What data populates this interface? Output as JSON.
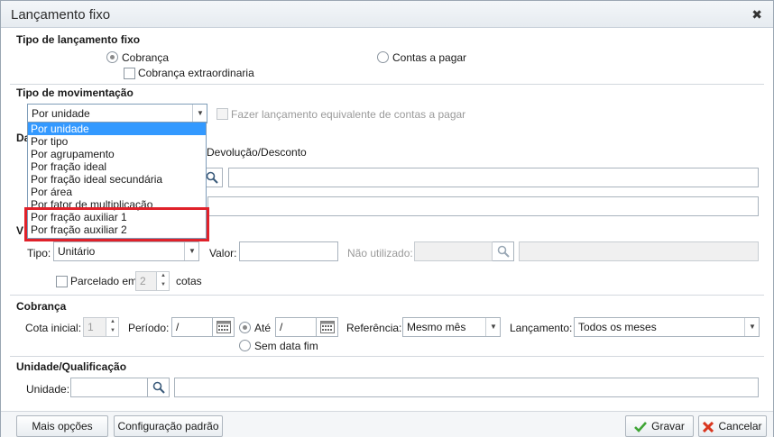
{
  "window": {
    "title": "Lançamento fixo",
    "close_icon": "close-icon"
  },
  "tipo_lancamento": {
    "section_title": "Tipo de lançamento fixo",
    "cobranca_label": "Cobrança",
    "cobranca_extra_label": "Cobrança extraordinaria",
    "contas_pagar_label": "Contas a pagar",
    "selected": "Cobrança"
  },
  "tipo_movimentacao": {
    "section_title": "Tipo de movimentação",
    "combo_value": "Por unidade",
    "equivalente_label": "Fazer lançamento equivalente de contas a pagar",
    "options": [
      "Por unidade",
      "Por tipo",
      "Por agrupamento",
      "Por fração ideal",
      "Por fração ideal secundária",
      "Por área",
      "Por fator de multiplicação",
      "Por fração auxiliar 1",
      "Por fração auxiliar 2"
    ],
    "highlighted_options": [
      "Por fração auxiliar 1",
      "Por fração auxiliar 2"
    ],
    "highlight_color": "#e0212a",
    "selection_color": "#3399ff"
  },
  "dados": {
    "section_title_partial": "Da",
    "devolucao_label": "Devolução/Desconto"
  },
  "valor": {
    "section_title_partial": "V",
    "tipo_label": "Tipo:",
    "tipo_value": "Unitário",
    "valor_label": "Valor:",
    "valor_value": "",
    "nao_utilizado_label": "Não utilizado:",
    "parcelado_label": "Parcelado em",
    "parcelado_value": "2",
    "cotas_label": "cotas"
  },
  "cobranca": {
    "section_title": "Cobrança",
    "cota_inicial_label": "Cota inicial:",
    "cota_inicial_value": "1",
    "periodo_label": "Período:",
    "periodo_start": "/",
    "ate_label": "Até",
    "periodo_end": "/",
    "sem_data_fim_label": "Sem data fim",
    "referencia_label": "Referência:",
    "referencia_value": "Mesmo mês",
    "lancamento_label": "Lançamento:",
    "lancamento_value": "Todos os meses"
  },
  "unidade": {
    "section_title": "Unidade/Qualificação",
    "unidade_label": "Unidade:",
    "unidade_value": ""
  },
  "footer": {
    "mais_opcoes": "Mais opções",
    "configuracao_padrao": "Configuração padrão",
    "gravar": "Gravar",
    "cancelar": "Cancelar"
  }
}
